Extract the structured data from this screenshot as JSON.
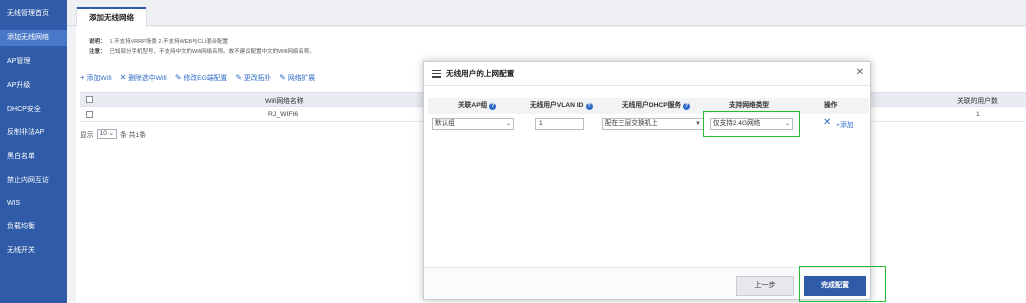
{
  "sidebar": {
    "items": [
      {
        "label": "无线管理首页"
      },
      {
        "label": "添加无线网络"
      },
      {
        "label": "AP管理"
      },
      {
        "label": "AP升级"
      },
      {
        "label": "DHCP安全"
      },
      {
        "label": "反制非法AP"
      },
      {
        "label": "黑白名单"
      },
      {
        "label": "禁止内网互访"
      },
      {
        "label": "WIS"
      },
      {
        "label": "负载均衡"
      },
      {
        "label": "无线开关"
      }
    ]
  },
  "tab": {
    "label": "添加无线网络"
  },
  "notes": {
    "line1_key": "说明：",
    "line1_text": "1.不支持VRRP场景 2.不支持WEB与CLI混合配置",
    "line2_key": "注意：",
    "line2_text": "已知部分手机型号，不支持中文的Wifi网络名称。故不建议配置中文的Wifi网络名称。"
  },
  "toolbar": {
    "add": "添加Wifi",
    "delete": "删除选中Wifi",
    "modify_eg": "修改EG端配置",
    "change_topo": "更改拓扑",
    "expand": "网络扩展"
  },
  "grid": {
    "header_name": "Wifi网络名称",
    "header_users": "关联的用户数",
    "rows": [
      {
        "name": "RJ_WIFI6",
        "users": "1"
      }
    ]
  },
  "pager": {
    "show": "显示",
    "page_size": "10",
    "total": "条 共1条"
  },
  "modal": {
    "title": "无线用户的上网配置",
    "headers": {
      "ap_group": "关联AP组",
      "vlan": "无线用户VLAN ID",
      "dhcp": "无线用户DHCP服务",
      "net_type": "支持网络类型",
      "action": "操作"
    },
    "row": {
      "ap_group": "默认组",
      "vlan": "1",
      "dhcp": "配在三层交换机上",
      "net_type": "仅支持2.4G网络",
      "add": "添加"
    },
    "buttons": {
      "prev": "上一步",
      "finish": "完成配置"
    }
  },
  "colors": {
    "sidebar": "#2f5ba8",
    "sidebar_active": "#4a78c8",
    "link": "#2f6bc8",
    "highlight": "#28b838"
  }
}
